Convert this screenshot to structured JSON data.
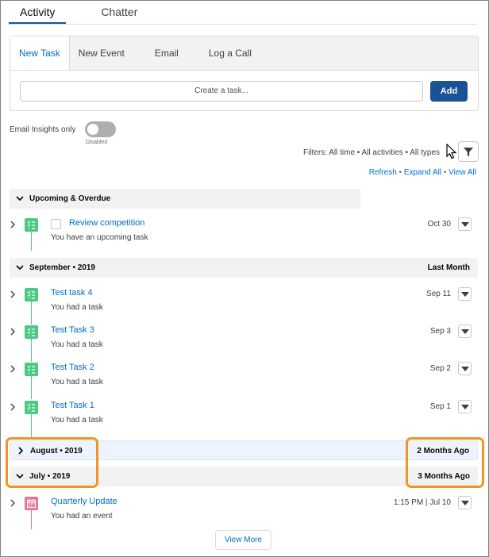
{
  "tabs": {
    "activity": "Activity",
    "chatter": "Chatter"
  },
  "composer": {
    "tabs": [
      "New Task",
      "New Event",
      "Email",
      "Log a Call"
    ],
    "task_placeholder": "Create a task...",
    "add_label": "Add"
  },
  "insights": {
    "label": "Email Insights only",
    "state": "Disabled",
    "enabled": false
  },
  "filters": {
    "text": "Filters: All time • All activities • All types",
    "refresh": "Refresh",
    "expand_all": "Expand All",
    "view_all": "View All",
    "sep": " • "
  },
  "sections": {
    "upcoming": {
      "title": "Upcoming & Overdue",
      "right": ""
    },
    "september": {
      "title": "September • 2019",
      "right": "Last Month"
    },
    "august": {
      "title": "August • 2019",
      "right": "2 Months Ago"
    },
    "july": {
      "title": "July • 2019",
      "right": "3 Months Ago"
    }
  },
  "items": {
    "upcoming": [
      {
        "title": "Review competition",
        "sub": "You have an upcoming task",
        "date": "Oct 30",
        "icon": "task-icon"
      }
    ],
    "september": [
      {
        "title": "Test task 4",
        "sub": "You had a task",
        "date": "Sep 11",
        "icon": "task-icon"
      },
      {
        "title": "Test Task 3",
        "sub": "You had a task",
        "date": "Sep 3",
        "icon": "task-icon"
      },
      {
        "title": "Test Task 2",
        "sub": "You had a task",
        "date": "Sep 2",
        "icon": "task-icon"
      },
      {
        "title": "Test Task 1",
        "sub": "You had a task",
        "date": "Sep 1",
        "icon": "task-icon"
      }
    ],
    "july": [
      {
        "title": "Quarterly Update",
        "sub": "You had an event",
        "date": "1:15 PM | Jul 10",
        "icon": "event-icon"
      }
    ]
  },
  "view_more": "View More",
  "colors": {
    "task": "#4bca81",
    "event": "#eb7092",
    "link": "#006dcc",
    "brand": "#1b5297",
    "highlight": "#ee9524"
  }
}
